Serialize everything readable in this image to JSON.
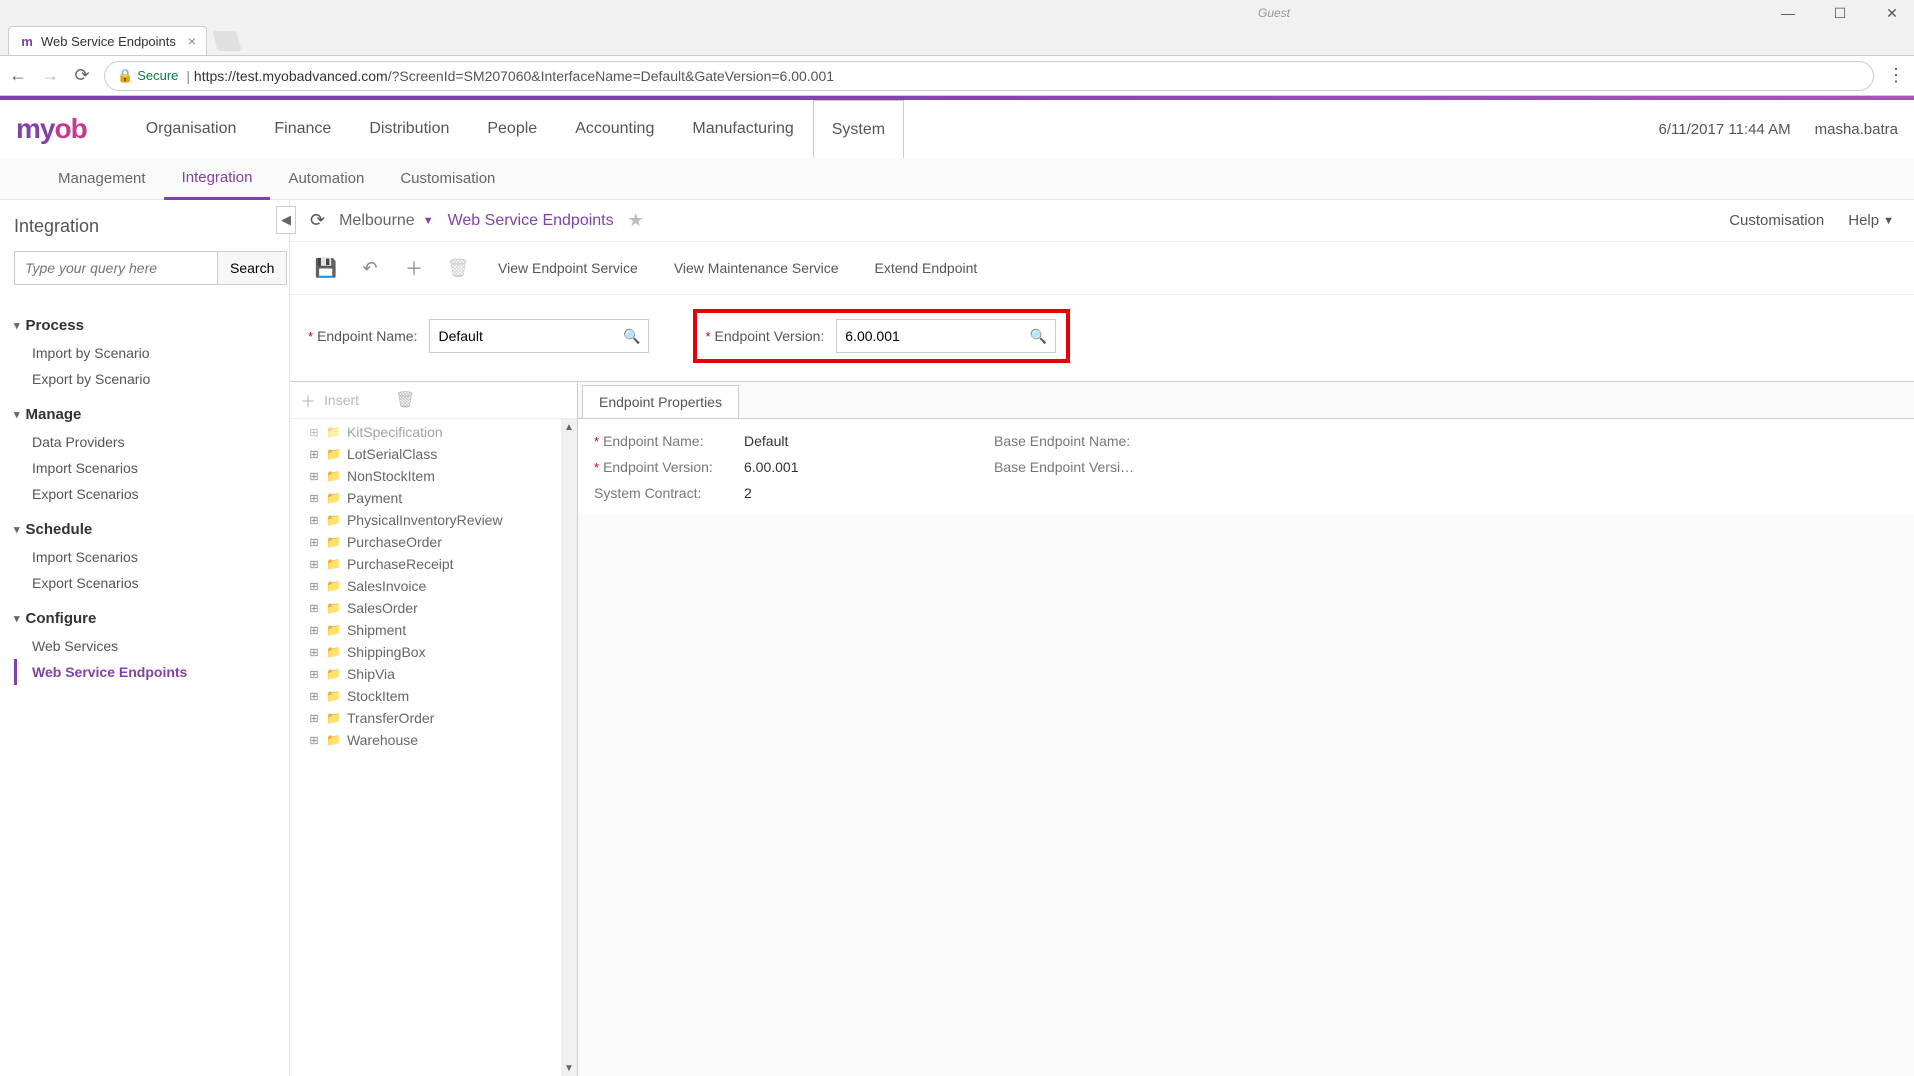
{
  "browser": {
    "guest": "Guest",
    "tab_title": "Web Service Endpoints",
    "url_secure": "Secure",
    "url_origin": "https://test.myobadvanced.com",
    "url_path": "/?ScreenId=SM207060&InterfaceName=Default&GateVersion=6.00.001"
  },
  "header": {
    "logo": "myob",
    "nav": [
      "Organisation",
      "Finance",
      "Distribution",
      "People",
      "Accounting",
      "Manufacturing",
      "System"
    ],
    "nav_active": "System",
    "datetime": "6/11/2017  11:44 AM",
    "user": "masha.batra"
  },
  "subnav": {
    "items": [
      "Management",
      "Integration",
      "Automation",
      "Customisation"
    ],
    "active": "Integration"
  },
  "sidebar": {
    "title": "Integration",
    "search_placeholder": "Type your query here",
    "search_button": "Search",
    "sections": [
      {
        "title": "Process",
        "items": [
          "Import by Scenario",
          "Export by Scenario"
        ]
      },
      {
        "title": "Manage",
        "items": [
          "Data Providers",
          "Import Scenarios",
          "Export Scenarios"
        ]
      },
      {
        "title": "Schedule",
        "items": [
          "Import Scenarios",
          "Export Scenarios"
        ]
      },
      {
        "title": "Configure",
        "items": [
          "Web Services",
          "Web Service Endpoints"
        ]
      }
    ],
    "active": "Web Service Endpoints"
  },
  "breadcrumb": {
    "context": "Melbourne",
    "page": "Web Service Endpoints",
    "right1": "Customisation",
    "right2": "Help"
  },
  "toolbar": {
    "view_endpoint_service": "View Endpoint Service",
    "view_maintenance_service": "View Maintenance Service",
    "extend_endpoint": "Extend Endpoint"
  },
  "form": {
    "endpoint_name_label": "Endpoint Name:",
    "endpoint_name_value": "Default",
    "endpoint_version_label": "Endpoint Version:",
    "endpoint_version_value": "6.00.001"
  },
  "tree": {
    "insert": "Insert",
    "items": [
      "KitSpecification",
      "LotSerialClass",
      "NonStockItem",
      "Payment",
      "PhysicalInventoryReview",
      "PurchaseOrder",
      "PurchaseReceipt",
      "SalesInvoice",
      "SalesOrder",
      "Shipment",
      "ShippingBox",
      "ShipVia",
      "StockItem",
      "TransferOrder",
      "Warehouse"
    ]
  },
  "panel": {
    "tab": "Endpoint Properties",
    "rows": {
      "endpoint_name_label": "Endpoint Name:",
      "endpoint_name_value": "Default",
      "endpoint_version_label": "Endpoint Version:",
      "endpoint_version_value": "6.00.001",
      "system_contract_label": "System Contract:",
      "system_contract_value": "2",
      "base_endpoint_name_label": "Base Endpoint Name:",
      "base_endpoint_version_label": "Base Endpoint Versi…"
    }
  }
}
